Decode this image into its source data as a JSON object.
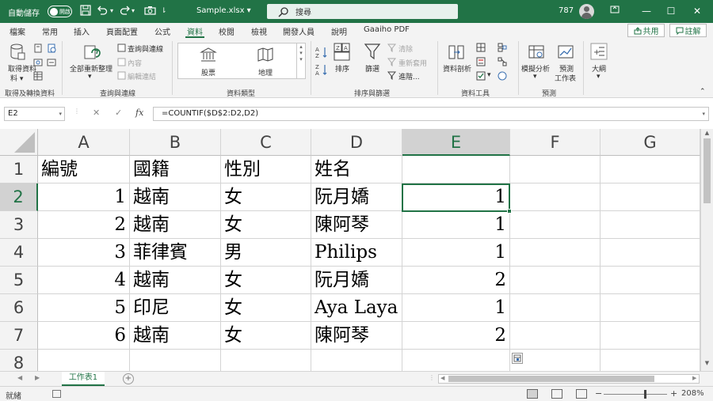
{
  "titlebar": {
    "autosave_label": "自動儲存",
    "autosave_state": "開啟",
    "filename": "Sample.xlsx",
    "search_placeholder": "搜尋",
    "count": "787",
    "minimize": "—",
    "restore": "☐",
    "close": "✕"
  },
  "tabs": {
    "items": [
      "檔案",
      "常用",
      "插入",
      "頁面配置",
      "公式",
      "資料",
      "校閱",
      "檢視",
      "開發人員",
      "說明",
      "Gaaiho PDF"
    ],
    "active": "資料",
    "share": "共用",
    "comment": "註解"
  },
  "ribbon": {
    "get_data": "取得資料",
    "get_data_sub": "料",
    "refresh_all": "全部重新整理",
    "queries_connections": "查詢與連線",
    "properties": "內容",
    "edit_links": "編輯連結",
    "stocks": "股票",
    "geography": "地理",
    "sort": "排序",
    "filter": "篩選",
    "clear": "清除",
    "reapply": "重新套用",
    "advanced": "進階...",
    "text_to_columns": "資料剖析",
    "what_if": "模擬分析",
    "forecast_sheet_1": "預測",
    "forecast_sheet_2": "工作表",
    "outline": "大綱",
    "groups": {
      "get_transform": "取得及轉換資料",
      "queries": "查詢與連線",
      "data_types": "資料類型",
      "sort_filter": "排序與篩選",
      "data_tools": "資料工具",
      "forecast": "預測"
    }
  },
  "formula_bar": {
    "name_box": "E2",
    "cancel": "✕",
    "enter": "✓",
    "fx": "fx",
    "formula": "=COUNTIF($D$2:D2,D2)"
  },
  "sheet": {
    "columns": [
      "A",
      "B",
      "C",
      "D",
      "E",
      "F",
      "G"
    ],
    "rows": [
      "1",
      "2",
      "3",
      "4",
      "5",
      "6",
      "7",
      "8"
    ],
    "selected_cell": "E2",
    "data": [
      [
        "編號",
        "國籍",
        "性別",
        "姓名",
        ""
      ],
      [
        "1",
        "越南",
        "女",
        "阮月嬌",
        "1"
      ],
      [
        "2",
        "越南",
        "女",
        "陳阿琴",
        "1"
      ],
      [
        "3",
        "菲律賓",
        "男",
        "Philips",
        "1"
      ],
      [
        "4",
        "越南",
        "女",
        "阮月嬌",
        "2"
      ],
      [
        "5",
        "印尼",
        "女",
        "Aya Laya",
        "1"
      ],
      [
        "6",
        "越南",
        "女",
        "陳阿琴",
        "2"
      ]
    ]
  },
  "sheet_tabs": {
    "active": "工作表1",
    "add": "+"
  },
  "statusbar": {
    "ready": "就緒",
    "zoom_out": "−",
    "zoom_in": "+",
    "zoom": "208%",
    "zoom_level_fraction": 0.65
  }
}
